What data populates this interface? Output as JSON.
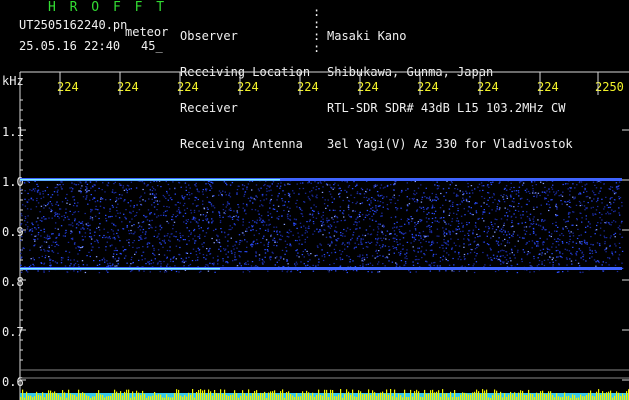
{
  "header": {
    "station": "H R O F F T",
    "filename": "UT2505162240.pn",
    "meteor_tag": "meteor",
    "datetime": "25.05.16 22:40",
    "count": "45_",
    "fields": [
      {
        "label": "Observer",
        "value": "Masaki Kano"
      },
      {
        "label": "Receiving Location",
        "value": "Shibukawa, Gunma, Japan"
      },
      {
        "label": "Receiver",
        "value": "RTL-SDR SDR# 43dB L15 103.2MHz CW"
      },
      {
        "label": "Receiving Antenna",
        "value": "3el Yagi(V) Az 330 for Vladivostok"
      }
    ]
  },
  "axis": {
    "unit": "kHz",
    "time_ticks": [
      "224",
      "224",
      "224",
      "224",
      "224",
      "224",
      "224",
      "224",
      "224",
      "2250"
    ],
    "freq_ticks": [
      "1.1",
      "1.0",
      "0.9",
      "0.8",
      "0.7",
      "0.6"
    ]
  },
  "colors": {
    "background": "#000000",
    "label_yellow": "#f2f22a",
    "title_green": "#33dd33",
    "signal_blue": "#2a4cff",
    "signal_cyan": "#7ff0ff",
    "meter_yellow": "#f2f200"
  }
}
